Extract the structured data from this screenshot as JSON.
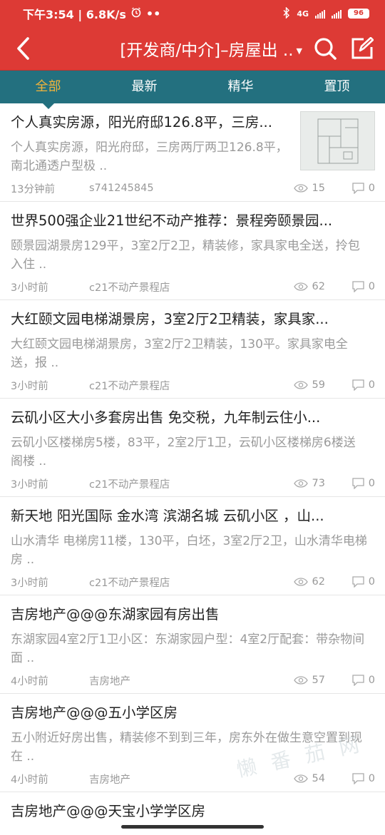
{
  "status_bar": {
    "time_speed": "下午3:54 | 6.8K/s",
    "dots": "••",
    "network": "4G",
    "battery": "96"
  },
  "app_bar": {
    "title": "[开发商/中介]–房屋出 ..",
    "icons": [
      "back-icon",
      "dropdown-caret-icon",
      "search-icon",
      "compose-icon"
    ]
  },
  "tabs": [
    {
      "label": "全部",
      "active": true
    },
    {
      "label": "最新",
      "active": false
    },
    {
      "label": "精华",
      "active": false
    },
    {
      "label": "置顶",
      "active": false
    }
  ],
  "posts": [
    {
      "title": "个人真实房源，阳光府邸126.8平，三房...",
      "desc": "个人真实房源，阳光府邸，三房两厅两卫126.8平，南北通透户型极 ..",
      "time": "13分钟前",
      "author": "s741245845",
      "views": "15",
      "comments": "0",
      "has_thumb": true
    },
    {
      "title": "世界500强企业21世纪不动产推荐：景程旁颐景园...",
      "desc": "颐景园湖景房129平，3室2厅2卫，精装修，家具家电全送，拎包入住 ..",
      "time": "3小时前",
      "author": "c21不动产景程店",
      "views": "62",
      "comments": "0"
    },
    {
      "title": "大红颐文园电梯湖景房，3室2厅2卫精装，家具家...",
      "desc": "大红颐文园电梯湖景房，3室2厅2卫精装，130平。家具家电全送，报 ..",
      "time": "3小时前",
      "author": "c21不动产景程店",
      "views": "59",
      "comments": "0"
    },
    {
      "title": "云矶小区大小多套房出售 免交税，九年制云住小...",
      "desc": "云矶小区楼梯房5楼，83平，2室2厅1卫，云矶小区楼梯房6楼送阁楼 ..",
      "time": "3小时前",
      "author": "c21不动产景程店",
      "views": "73",
      "comments": "0"
    },
    {
      "title": "新天地 阳光国际 金水湾 滨湖名城 云矶小区 ，山...",
      "desc": "山水清华 电梯房11楼，130平，白坯，3室2厅2卫，山水清华电梯房 ..",
      "time": "3小时前",
      "author": "c21不动产景程店",
      "views": "62",
      "comments": "0"
    },
    {
      "title": "吉房地产@@@东湖家园有房出售",
      "desc": "东湖家园4室2厅1卫小区：东湖家园户型：4室2厅配套：带杂物间面 ..",
      "time": "4小时前",
      "author": "吉房地产",
      "views": "57",
      "comments": "0"
    },
    {
      "title": "吉房地产@@@五小学区房",
      "desc": "五小附近好房出售，精装修不到到三年，房东外在做生意空置到现在 ..",
      "time": "4小时前",
      "author": "吉房地产",
      "views": "54",
      "comments": "0"
    }
  ],
  "partial_post": {
    "title": "吉房地产@@@天宝小学学区房"
  },
  "watermark": "懒 番 茄 网"
}
